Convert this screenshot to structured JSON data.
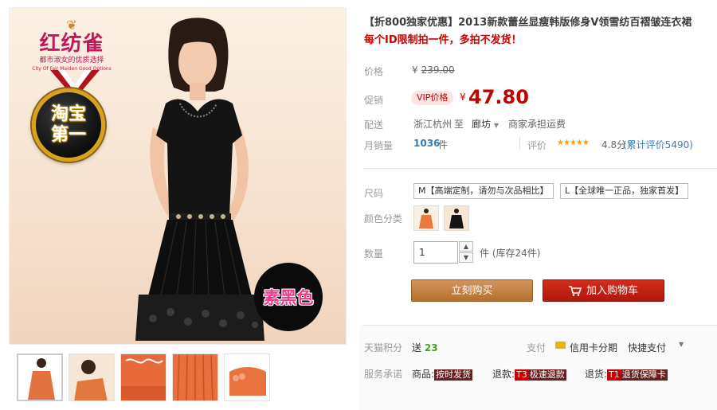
{
  "brand": {
    "name": "红纺雀",
    "slogan": "都市淑女的优质选择",
    "sub": "City Of Fair Maiden Good Options"
  },
  "badge": {
    "line1": "淘宝",
    "line2": "第一"
  },
  "color_badge": "素黑色",
  "title": "【折800独家优惠】2013新款蕾丝显瘦韩版修身V领雪纺百褶皱连衣裙",
  "subtitle": "每个ID限制拍一件，多拍不发货！",
  "price": {
    "label": "价格",
    "currency": "¥",
    "original": "239.00"
  },
  "promo": {
    "label": "促销",
    "tag": "VIP价格",
    "currency": "¥",
    "value": "47.80"
  },
  "shipping": {
    "label": "配送",
    "from": "浙江杭州",
    "to_word": "至",
    "to": "廊坊",
    "fee": "商家承担运费"
  },
  "sales": {
    "label": "月销量",
    "count": "1036",
    "unit": "件",
    "review_label": "评价",
    "stars": "★★★★★",
    "score": "4.8分",
    "review_count": "(累计评价5490)"
  },
  "size": {
    "label": "尺码",
    "options": [
      "M【高端定制，请勿与次品相比】",
      "L【全球唯一正品，独家首发】"
    ]
  },
  "color": {
    "label": "颜色分类"
  },
  "quantity": {
    "label": "数量",
    "value": "1",
    "up": "▲",
    "down": "▼",
    "unit": "件",
    "stock": "(库存24件)"
  },
  "actions": {
    "buy": "立刻购买",
    "cart": "加入购物车"
  },
  "points": {
    "label": "天猫积分",
    "prefix": "送",
    "value": "23"
  },
  "payment": {
    "label": "支付",
    "card": "信用卡分期",
    "quick": "快捷支付"
  },
  "service": {
    "label": "服务承诺",
    "items": [
      {
        "name": "商品:",
        "pre": "",
        "tag": "按时发货"
      },
      {
        "name": "退款:",
        "pre": "T3",
        "tag": "极速退款"
      },
      {
        "name": "退货:",
        "pre": "T1",
        "tag": "退货保障卡"
      }
    ]
  },
  "colors": {
    "accent": "#c40000",
    "buy_button": "#c2813f",
    "cart_button": "#c4200f",
    "link": "#3a7bba"
  }
}
